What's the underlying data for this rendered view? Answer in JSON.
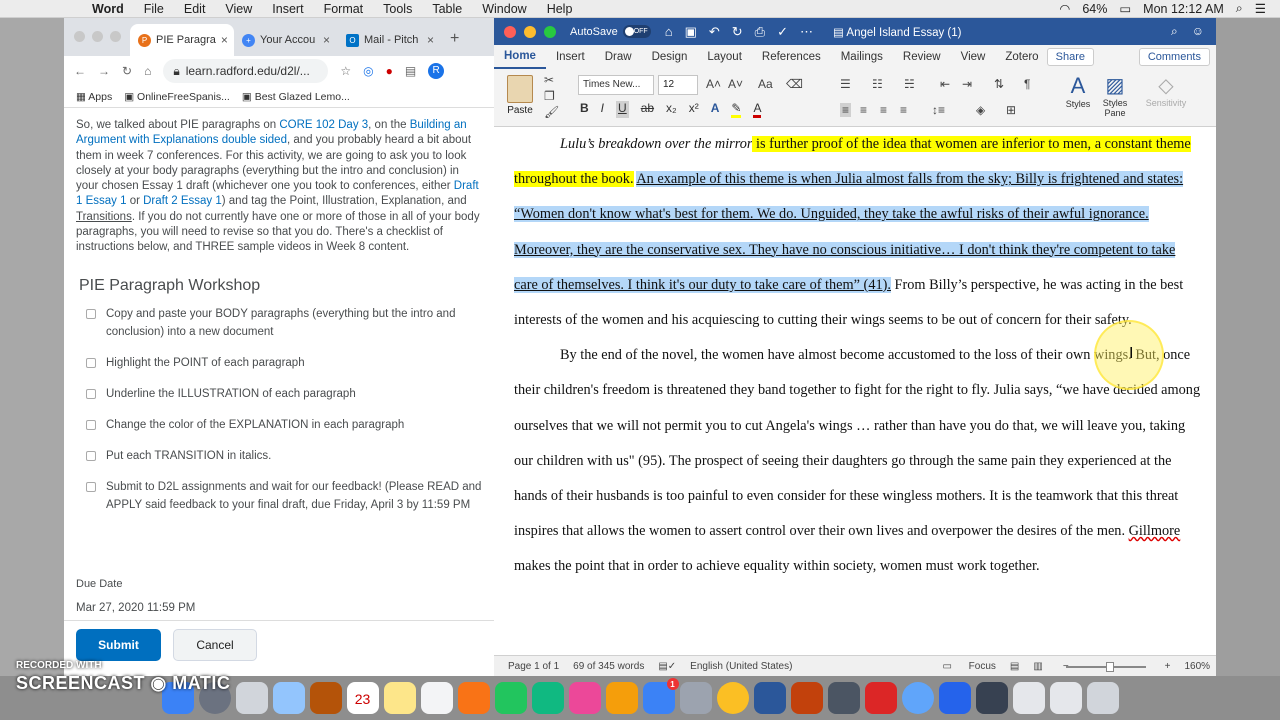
{
  "menubar": {
    "app": "Word",
    "items": [
      "File",
      "Edit",
      "View",
      "Insert",
      "Format",
      "Tools",
      "Table",
      "Window",
      "Help"
    ],
    "battery": "64%",
    "clock": "Mon 12:12 AM"
  },
  "chrome": {
    "tabs": [
      {
        "label": "PIE Paragra",
        "favicon": "P"
      },
      {
        "label": "Your Accou",
        "favicon": "+"
      },
      {
        "label": "Mail - Pitch",
        "favicon": "O"
      }
    ],
    "url": "learn.radford.edu/d2l/...",
    "bookmarks": [
      "Apps",
      "OnlineFreeSpanis...",
      "Best Glazed Lemo..."
    ]
  },
  "assignment": {
    "intro_parts": [
      "So, we talked about PIE paragraphs on ",
      "CORE 102 Day 3",
      ", on the ",
      "Building an Argument with Explanations double sided",
      ", and you probably heard a bit about them in week 7 conferences. For this activity, we are going to ask you to look closely at your body paragraphs (everything but the intro and conclusion) in your chosen Essay 1 draft (whichever one you took to conferences, either ",
      "Draft 1 Essay 1",
      " or ",
      "Draft 2 Essay 1",
      ") and tag the ",
      "Point",
      ", ",
      "Illustration",
      ", ",
      "Explanation",
      ", and ",
      "Transitions",
      ". If you do not currently have one or more of those in all of your body paragraphs, you will need to revise so that you do.  There's a checklist of instructions below, and THREE sample videos in Week 8 content."
    ],
    "workshop_title": "PIE Paragraph Workshop",
    "checklist": [
      "Copy and paste your BODY paragraphs (everything but the intro and conclusion) into a new document",
      "Highlight the POINT of each paragraph",
      "Underline the ILLUSTRATION of each paragraph",
      "Change the color of the EXPLANATION in each paragraph",
      "Put each TRANSITION in italics.",
      "Submit to D2L assignments and wait for our feedback! (Please READ and APPLY said feedback to your final draft, due Friday, April 3 by 11:59 PM"
    ],
    "due_label": "Due Date",
    "due_value": "Mar 27, 2020 11:59 PM",
    "submit": "Submit",
    "cancel": "Cancel"
  },
  "word": {
    "autosave": "AutoSave",
    "toggle": "OFF",
    "doc_title": "Angel Island Essay (1)",
    "tabs": [
      "Home",
      "Insert",
      "Draw",
      "Design",
      "Layout",
      "References",
      "Mailings",
      "Review",
      "View",
      "Zotero"
    ],
    "share": "Share",
    "comments": "Comments",
    "font": "Times New...",
    "size": "12",
    "paste": "Paste",
    "styles": "Styles",
    "styles_pane": "Styles Pane",
    "sensitivity": "Sensitivity",
    "p1": {
      "italic": "Lulu’s breakdown over the mirror",
      "yellow": " is further proof of the idea that women are inferior to men, a constant theme throughout the book.",
      "space": " ",
      "blue": "An example of this theme is when Julia almost falls from the sky; Billy is frightened and states: “Women don't know what's best for them. We do. Unguided, they take the awful risks of their awful ignorance. Moreover, they are the conservative sex. They have no conscious initiative… I don't think they're competent to take care of themselves. I think it's our duty to take care of them” (41).",
      "rest": " From Billy’s perspective, he was acting in the best interests of the women and his acquiescing to cutting their wings seems to be out of concern for their safety."
    },
    "p2": {
      "text1": "By the end of the novel, the women have almost become accustomed to the loss of their own wings. But, once their children's freedom is threatened they band together to fight for the right to fly. Julia says, “we have decided among ourselves that we will not permit you to cut Angela's wings … rather than have you do that, we will leave you, taking our children with us\" (95). The prospect of seeing their daughters go through the same pain they experienced at the hands of their husbands is too painful to even consider for these wingless mothers. It is the teamwork that this threat inspires that allows the women to assert control over their own lives and overpower the desires of the men. ",
      "name": "Gillmore",
      "text2": " makes the point that in order to achieve equality within society, women must work together."
    },
    "status": {
      "page": "Page 1 of 1",
      "words": "69 of 345 words",
      "lang": "English (United States)",
      "focus": "Focus",
      "zoom": "160%"
    }
  },
  "watermark": {
    "line1": "RECORDED WITH",
    "line2": "SCREENCAST",
    "line3": "MATIC"
  },
  "dock": {
    "calendar_day": "23",
    "badge": "1"
  },
  "colors": {
    "word_blue": "#2b579a",
    "d2l_blue": "#006fbf",
    "highlight_yellow": "#ffff00",
    "select_blue": "#b4d7f8"
  }
}
